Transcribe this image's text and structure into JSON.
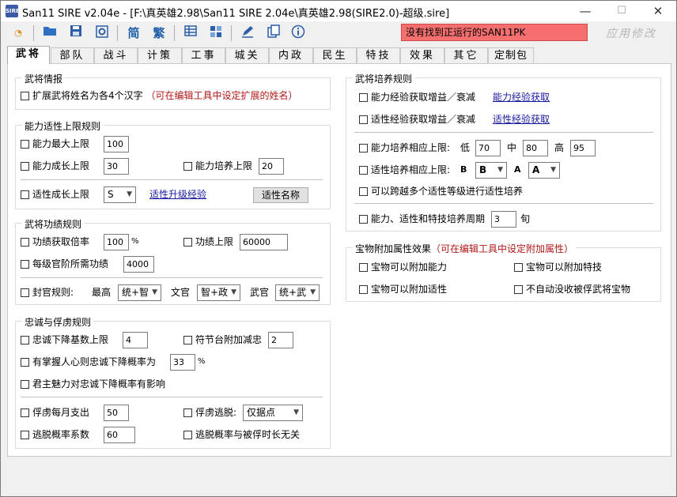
{
  "window": {
    "title": "San11 SIRE v2.04e - [F:\\真英雄2.98\\San11 SIRE 2.04e\\真英雄2.98(SIRE2.0)-超级.sire]",
    "minimize": "—",
    "maximize": "☐",
    "close": "✕"
  },
  "toolbar": {
    "status_text": "没有找到正运行的SAN11PK",
    "apply_label": "应用修改",
    "icons": [
      "san11-icon",
      "open-folder-icon",
      "save-icon",
      "settings-icon",
      "simplified-chinese-icon",
      "traditional-chinese-icon",
      "table-icon",
      "network-icon",
      "edit-icon",
      "copy-icon",
      "info-icon"
    ],
    "simplified_label": "简",
    "traditional_label": "繁"
  },
  "tabs": [
    "武将",
    "部队",
    "战斗",
    "计策",
    "工事",
    "城关",
    "内政",
    "民生",
    "特技",
    "效果",
    "其它",
    "定制包"
  ],
  "officer_info": {
    "legend": "武将情报",
    "extend_name_label": "扩展武将姓名为各4个汉字",
    "extend_name_note": "（可在编辑工具中设定扩展的姓名）"
  },
  "ability_limit": {
    "legend": "能力适性上限规则",
    "max_label": "能力最大上限",
    "max_value": "100",
    "growth_label": "能力成长上限",
    "growth_value": "30",
    "train_label": "能力培养上限",
    "train_value": "20",
    "apt_growth_label": "适性成长上限",
    "apt_growth_value": "S",
    "apt_upgrade_link": "适性升级经验",
    "apt_name_button": "适性名称"
  },
  "merit": {
    "legend": "武将功绩规则",
    "rate_label": "功绩获取倍率",
    "rate_value": "100",
    "rate_unit": "%",
    "limit_label": "功绩上限",
    "limit_value": "60000",
    "per_rank_label": "每级官阶所需功绩",
    "per_rank_value": "4000",
    "title_rule_label": "封官规则:",
    "highest_label": "最高",
    "highest_value": "统+智",
    "civil_label": "文官",
    "civil_value": "智+政",
    "military_label": "武官",
    "military_value": "统+武"
  },
  "loyalty": {
    "legend": "忠诚与俘虏规则",
    "base_drop_label": "忠诚下降基数上限",
    "base_drop_value": "4",
    "tally_label": "符节台附加减忠",
    "tally_value": "2",
    "heart_label": "有掌握人心则忠诚下降概率为",
    "heart_value": "33",
    "heart_unit": "%",
    "charisma_label": "君主魅力对忠诚下降概率有影响",
    "captive_cost_label": "俘虏每月支出",
    "captive_cost_value": "50",
    "captive_escape_label": "俘虏逃脱:",
    "captive_escape_value": "仅据点",
    "escape_coef_label": "逃脱概率系数",
    "escape_coef_value": "60",
    "escape_time_label": "逃脱概率与被俘时长无关"
  },
  "training": {
    "legend": "武将培养规则",
    "ability_exp_label": "能力经验获取增益／衰减",
    "ability_exp_link": "能力经验获取",
    "apt_exp_label": "适性经验获取增益／衰减",
    "apt_exp_link": "适性经验获取",
    "ability_train_label": "能力培养相应上限:",
    "low_label": "低",
    "low_value": "70",
    "mid_label": "中",
    "mid_value": "80",
    "high_label": "高",
    "high_value": "95",
    "apt_train_label": "适性培养相应上限:",
    "apt_low_label": "B",
    "apt_low_value": "B",
    "apt_high_label": "A",
    "apt_high_value": "A",
    "skip_label": "可以跨越多个适性等级进行适性培养",
    "period_label": "能力、适性和特技培养周期",
    "period_value": "3",
    "period_unit": "旬"
  },
  "treasure": {
    "legend": "宝物附加属性效果",
    "legend_note": "（可在编辑工具中设定附加属性）",
    "ability_label": "宝物可以附加能力",
    "skill_label": "宝物可以附加特技",
    "apt_label": "宝物可以附加适性",
    "no_confiscate_label": "不自动没收被俘武将宝物"
  }
}
